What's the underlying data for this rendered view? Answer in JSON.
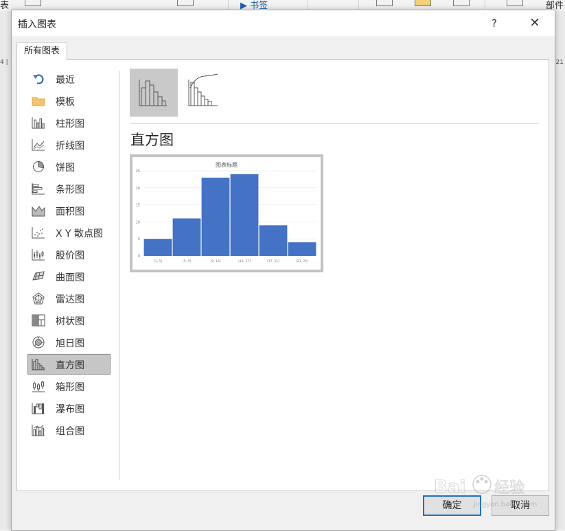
{
  "background": {
    "ribbon_left": "表",
    "ribbon_bookmark": "▶ 书签",
    "ribbon_right": "部件",
    "ruler_left": "4 |",
    "ruler_right": "21"
  },
  "dialog": {
    "title": "插入图表",
    "help": "?",
    "close": "✕",
    "tab": "所有图表",
    "sidebar": [
      {
        "label": "最近",
        "icon": "undo-arrow-icon"
      },
      {
        "label": "模板",
        "icon": "folder-icon"
      },
      {
        "label": "柱形图",
        "icon": "column-chart-icon"
      },
      {
        "label": "折线图",
        "icon": "line-chart-icon"
      },
      {
        "label": "饼图",
        "icon": "pie-chart-icon"
      },
      {
        "label": "条形图",
        "icon": "bar-chart-icon"
      },
      {
        "label": "面积图",
        "icon": "area-chart-icon"
      },
      {
        "label": "X Y 散点图",
        "icon": "scatter-chart-icon"
      },
      {
        "label": "股价图",
        "icon": "stock-chart-icon"
      },
      {
        "label": "曲面图",
        "icon": "surface-chart-icon"
      },
      {
        "label": "雷达图",
        "icon": "radar-chart-icon"
      },
      {
        "label": "树状图",
        "icon": "treemap-chart-icon"
      },
      {
        "label": "旭日图",
        "icon": "sunburst-chart-icon"
      },
      {
        "label": "直方图",
        "icon": "histogram-chart-icon",
        "selected": true
      },
      {
        "label": "箱形图",
        "icon": "box-whisker-chart-icon"
      },
      {
        "label": "瀑布图",
        "icon": "waterfall-chart-icon"
      },
      {
        "label": "组合图",
        "icon": "combo-chart-icon"
      }
    ],
    "subtypes": [
      {
        "name": "histogram",
        "icon": "histogram-subtype-icon",
        "selected": true
      },
      {
        "name": "pareto",
        "icon": "pareto-subtype-icon",
        "selected": false
      }
    ],
    "heading": "直方图",
    "ok": "确定",
    "cancel": "取消"
  },
  "chart_data": {
    "type": "bar",
    "title": "图表标题",
    "categories": [
      "[1, 5]",
      "(5, 9]",
      "(9, 13]",
      "(13, 17]",
      "(17, 21]",
      "(21, 25]"
    ],
    "values": [
      5,
      11,
      23,
      24,
      9,
      4
    ],
    "ylim": [
      0,
      25
    ],
    "yticks": [
      "0",
      "5",
      "10",
      "15",
      "20",
      "25"
    ],
    "grid": true,
    "bar_color": "#4472c4"
  },
  "watermark": "Baidu 经验  jingyan.baidu.com"
}
